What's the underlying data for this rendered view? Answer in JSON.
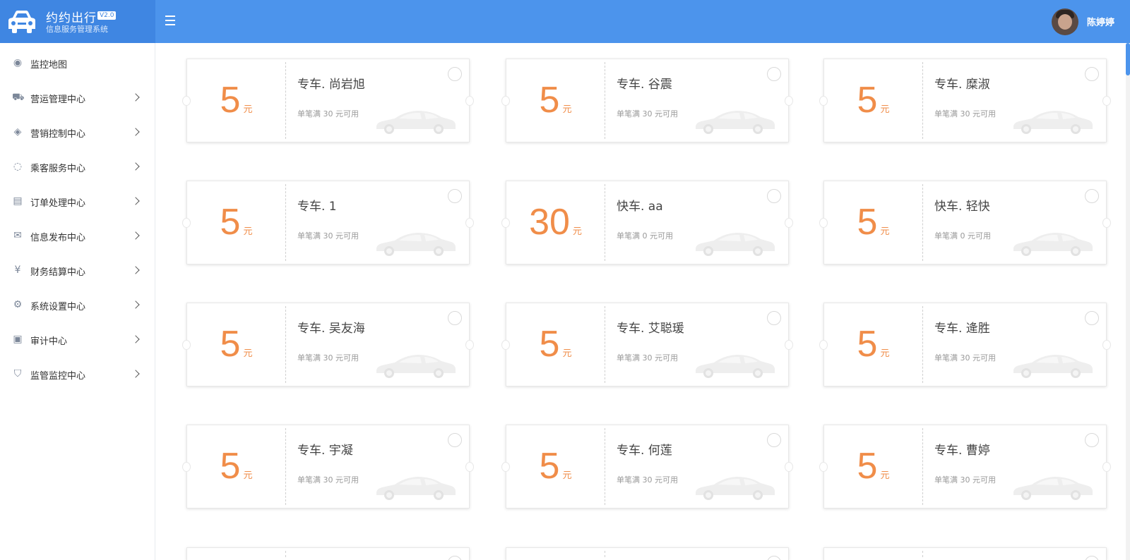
{
  "header": {
    "app_title": "约约出行",
    "version": "V2.0",
    "subtitle": "信息服务管理系统",
    "username": "陈婷婷"
  },
  "sidebar": {
    "items": [
      {
        "label": "监控地图",
        "icon": "map-pin-icon",
        "has_children": false
      },
      {
        "label": "营运管理中心",
        "icon": "car-icon",
        "has_children": true
      },
      {
        "label": "营销控制中心",
        "icon": "tag-icon",
        "has_children": true
      },
      {
        "label": "乘客服务中心",
        "icon": "lightbulb-icon",
        "has_children": true
      },
      {
        "label": "订单处理中心",
        "icon": "document-icon",
        "has_children": true
      },
      {
        "label": "信息发布中心",
        "icon": "mail-icon",
        "has_children": true
      },
      {
        "label": "财务结算中心",
        "icon": "yen-icon",
        "has_children": true
      },
      {
        "label": "系统设置中心",
        "icon": "gear-icon",
        "has_children": true
      },
      {
        "label": "审计中心",
        "icon": "monitor-chart-icon",
        "has_children": true
      },
      {
        "label": "监管监控中心",
        "icon": "shield-icon",
        "has_children": true
      }
    ]
  },
  "coupons": [
    {
      "amount": "5",
      "unit": "元",
      "name": "专车. 尚岩旭",
      "condition": "单笔满 30 元可用"
    },
    {
      "amount": "5",
      "unit": "元",
      "name": "专车. 谷震",
      "condition": "单笔满 30 元可用"
    },
    {
      "amount": "5",
      "unit": "元",
      "name": "专车. 糜淑",
      "condition": "单笔满 30 元可用"
    },
    {
      "amount": "5",
      "unit": "元",
      "name": "专车. 1",
      "condition": "单笔满 30 元可用"
    },
    {
      "amount": "30",
      "unit": "元",
      "name": "快车. aa",
      "condition": "单笔满 0 元可用"
    },
    {
      "amount": "5",
      "unit": "元",
      "name": "快车. 轻快",
      "condition": "单笔满 0 元可用"
    },
    {
      "amount": "5",
      "unit": "元",
      "name": "专车. 吴友海",
      "condition": "单笔满 30 元可用"
    },
    {
      "amount": "5",
      "unit": "元",
      "name": "专车. 艾聪瑗",
      "condition": "单笔满 30 元可用"
    },
    {
      "amount": "5",
      "unit": "元",
      "name": "专车. 逄胜",
      "condition": "单笔满 30 元可用"
    },
    {
      "amount": "5",
      "unit": "元",
      "name": "专车. 宇凝",
      "condition": "单笔满 30 元可用"
    },
    {
      "amount": "5",
      "unit": "元",
      "name": "专车. 何莲",
      "condition": "单笔满 30 元可用"
    },
    {
      "amount": "5",
      "unit": "元",
      "name": "专车. 曹婷",
      "condition": "单笔满 30 元可用"
    }
  ],
  "colors": {
    "header_bg": "#4c94ec",
    "brand_bg": "#3f86e2",
    "amount": "#f08d49"
  }
}
